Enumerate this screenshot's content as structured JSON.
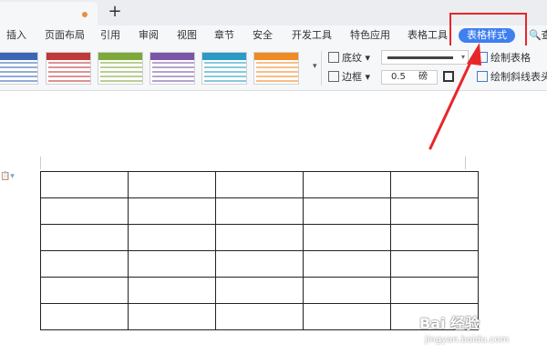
{
  "ribbon": {
    "tabs": [
      "插入",
      "页面布局",
      "引用",
      "审阅",
      "视图",
      "章节",
      "安全",
      "开发工具",
      "特色应用",
      "表格工具",
      "表格样式"
    ],
    "active_tab": "表格样式",
    "search_fragment": "查"
  },
  "toolbar": {
    "shading_label": "底纹",
    "border_label": "边框",
    "line_width_value": "0.5",
    "line_width_unit": "磅",
    "draw_table_label": "绘制表格",
    "draw_diagonal_header_label": "绘制斜线表头",
    "style_gallery_colors": [
      "#3a66b8",
      "#c0393b",
      "#7ea83a",
      "#7a55a8",
      "#2b9ac6",
      "#f08a24"
    ]
  },
  "document": {
    "table": {
      "rows": 6,
      "columns": 5
    }
  },
  "annotation": {
    "highlight_color": "#e8262a",
    "arrow_color": "#e8262a"
  },
  "watermark": {
    "brand": "Bai 经验",
    "url": "jingyan.baidu.com"
  }
}
